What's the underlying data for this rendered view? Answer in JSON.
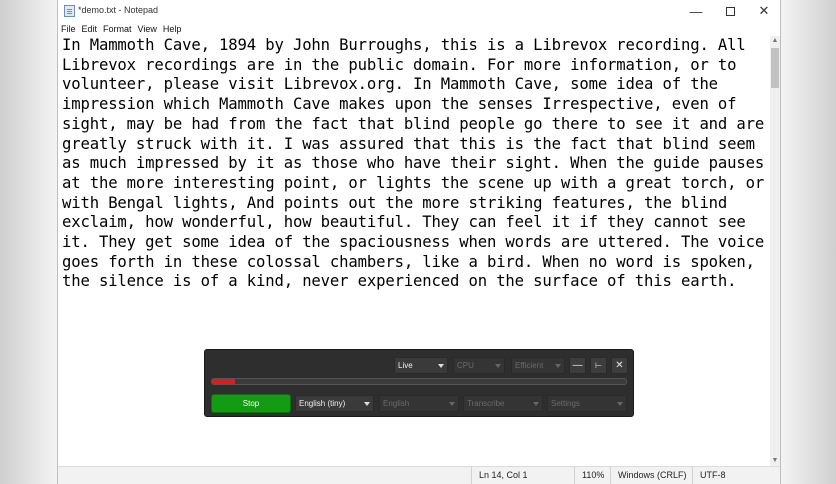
{
  "window": {
    "title": "*demo.txt - Notepad",
    "min_glyph": "—",
    "close_glyph": "✕"
  },
  "menu": [
    "File",
    "Edit",
    "Format",
    "View",
    "Help"
  ],
  "editor": {
    "text": "In Mammoth Cave, 1894 by John Burroughs, this is a Librevox recording. All\nLibrevox recordings are in the public domain. For more information, or to\nvolunteer, please visit Librevox.org. In Mammoth Cave, some idea of the\nimpression which Mammoth Cave makes upon the senses Irrespective, even of\nsight, may be had from the fact that blind people go there to see it and are\ngreatly struck with it. I was assured that this is the fact that blind seem\nas much impressed by it as those who have their sight. When the guide pauses\nat the more interesting point, or lights the scene up with a great torch, or\nwith Bengal lights, And points out the more striking features, the blind\nexclaim, how wonderful, how beautiful. They can feel it if they cannot see\nit. They get some idea of the spaciousness when words are uttered. The voice\ngoes forth in these colossal chambers, like a bird. When no word is spoken,\nthe silence is of a kind, never experienced on the surface of this earth."
  },
  "statusbar": {
    "position": "Ln 14, Col 1",
    "zoom": "110%",
    "line_endings": "Windows (CRLF)",
    "encoding": "UTF-8"
  },
  "controls": {
    "mode": "Live",
    "device": "CPU",
    "quality": "Efficient",
    "min_glyph": "—",
    "pin_glyph": "⊢",
    "close_glyph": "✕",
    "progress": 0.055,
    "progress_color": "#e01b1b",
    "stop_label": "Stop",
    "stop_color": "#139b13",
    "source_model": "English (tiny)",
    "target_language": "English",
    "action": "Transcribe",
    "settings_label": "Settings"
  }
}
